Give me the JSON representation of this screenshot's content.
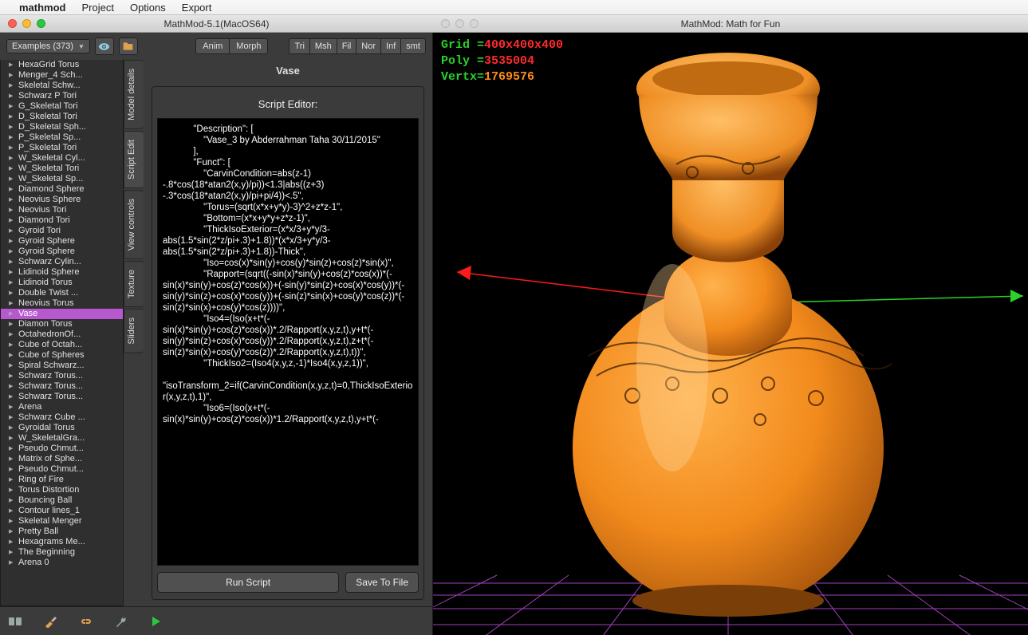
{
  "menubar": {
    "app": "mathmod",
    "items": [
      "Project",
      "Options",
      "Export"
    ]
  },
  "windows": {
    "left_title": "MathMod-5.1(MacOS64)",
    "right_title": "MathMod: Math for Fun"
  },
  "examples_combo": "Examples (373)",
  "anim_group": {
    "anim": "Anim",
    "morph": "Morph"
  },
  "view_group": {
    "tri": "Tri",
    "msh": "Msh",
    "fil": "Fil",
    "nor": "Nor",
    "inf": "Inf",
    "smt": "smt"
  },
  "tree": {
    "items": [
      "HexaGrid Torus",
      "Menger_4 Sch...",
      "Skeletal Schw...",
      "Schwarz P Tori",
      "G_Skeletal Tori",
      "D_Skeletal Tori",
      "D_Skeletal Sph...",
      "P_Skeletal Sp...",
      "P_Skeletal Tori",
      "W_Skeletal Cyl...",
      "W_Skeletal Tori",
      "W_Skeletal Sp...",
      "Diamond Sphere",
      "Neovius Sphere",
      "Neovius Tori",
      "Diamond Tori",
      "Gyroid Tori",
      "Gyroid Sphere",
      "Gyroid Sphere",
      "Schwarz Cylin...",
      "Lidinoid Sphere",
      "Lidinoid Torus",
      "Double Twist ...",
      "Neovius Torus",
      "Vase",
      "Diamon Torus",
      "OctahedronOf...",
      "Cube of Octah...",
      "Cube of Spheres",
      "Spiral Schwarz...",
      "Schwarz Torus...",
      "Schwarz Torus...",
      "Schwarz Torus...",
      "Arena",
      "Schwarz Cube ...",
      "Gyroidal Torus",
      "W_SkeletalGra...",
      "Pseudo Chmut...",
      "Matrix of Sphe...",
      "Pseudo Chmut...",
      "Ring of Fire",
      "Torus Distortion",
      "Bouncing Ball",
      "Contour lines_1",
      "Skeletal Menger",
      "Pretty Ball",
      "Hexagrams Me...",
      "The Beginning",
      "Arena 0"
    ],
    "selected_index": 24
  },
  "tabs": [
    "Model details",
    "Script Edit",
    "View controls",
    "Texture",
    "Sliders"
  ],
  "active_tab_index": 1,
  "editor": {
    "model_name": "Vase",
    "title": "Script Editor:",
    "code": "            \"Description\": [\n                \"Vase_3 by Abderrahman Taha 30/11/2015\"\n            ],\n            \"Funct\": [\n                \"CarvinCondition=abs(z-1) -.8*cos(18*atan2(x,y)/pi))<1.3|abs((z+3) -.3*cos(18*atan2(x,y)/pi+pi/4))<.5\",\n                \"Torus=(sqrt(x*x+y*y)-3)^2+z*z-1\",\n                \"Bottom=(x*x+y*y+z*z-1)\",\n                \"ThickIsoExterior=(x*x/3+y*y/3-abs(1.5*sin(2*z/pi+.3)+1.8))*(x*x/3+y*y/3-abs(1.5*sin(2*z/pi+.3)+1.8))-Thick\",\n                \"Iso=cos(x)*sin(y)+cos(y)*sin(z)+cos(z)*sin(x)\",\n                \"Rapport=(sqrt((-sin(x)*sin(y)+cos(z)*cos(x))*(-sin(x)*sin(y)+cos(z)*cos(x))+(-sin(y)*sin(z)+cos(x)*cos(y))*(-sin(y)*sin(z)+cos(x)*cos(y))+(-sin(z)*sin(x)+cos(y)*cos(z))*(-sin(z)*sin(x)+cos(y)*cos(z))))\",\n                \"Iso4=(Iso(x+t*(-sin(x)*sin(y)+cos(z)*cos(x))*.2/Rapport(x,y,z,t),y+t*(-sin(y)*sin(z)+cos(x)*cos(y))*.2/Rapport(x,y,z,t),z+t*(-sin(z)*sin(x)+cos(y)*cos(z))*.2/Rapport(x,y,z,t),t))\",\n                \"ThickIso2=(Iso4(x,y,z,-1)*Iso4(x,y,z,1))\",\n                \"isoTransform_2=if(CarvinCondition(x,y,z,t)=0,ThickIsoExterior(x,y,z,t),1)\",\n                \"Iso6=(Iso(x+t*(-sin(x)*sin(y)+cos(z)*cos(x))*1.2/Rapport(x,y,z,t),y+t*(-",
    "run_label": "Run Script",
    "save_label": "Save To File"
  },
  "render_stats": {
    "grid_label": "Grid = ",
    "grid_value": "400x400x400",
    "poly_label": "Poly = ",
    "poly_value": "3535004",
    "vert_label": "Vertx= ",
    "vert_value": "1769576"
  }
}
